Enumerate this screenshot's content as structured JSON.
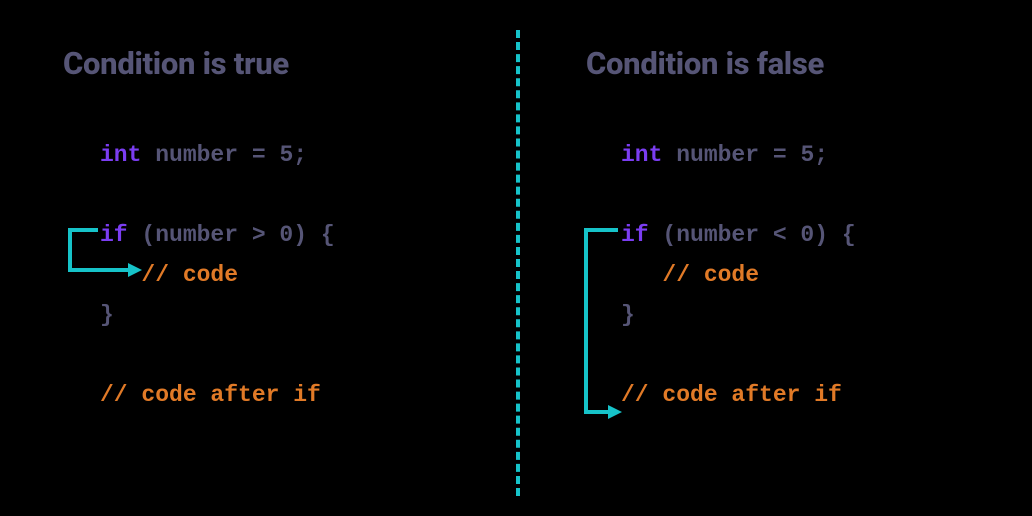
{
  "left": {
    "heading": "Condition is true",
    "line1_kw": "int",
    "line1_rest": " number = 5;",
    "line3_kw": "if",
    "line3_rest": " (number > 0) {",
    "line4_comment": "// code",
    "line5": "}",
    "line7_comment": "// code after if"
  },
  "right": {
    "heading": "Condition is false",
    "line1_kw": "int",
    "line1_rest": " number = 5;",
    "line3_kw": "if",
    "line3_rest": " (number < 0) {",
    "line4_comment": "// code",
    "line5": "}",
    "line7_comment": "// code after if"
  },
  "colors": {
    "background": "#000000",
    "heading": "#565576",
    "keyword": "#7b3df2",
    "dim": "#565576",
    "comment": "#e17a27",
    "accent": "#16c3c9"
  }
}
